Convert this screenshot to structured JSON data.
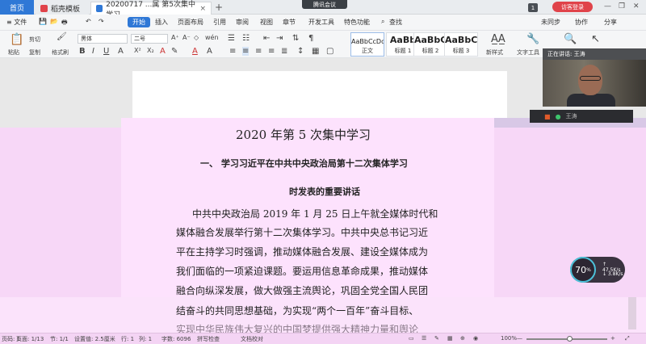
{
  "titlebar": {
    "tab_home": "首页",
    "tab_templates": "稻壳模板",
    "tab_doc": "20200717 ...属  第5次集中学习",
    "tab_close": "×",
    "add_tab": "+",
    "meeting_chip": "腾讯会议",
    "page_badge": "1",
    "visitor_button": "访客登录",
    "minimize": "—",
    "restore": "❐",
    "close": "✕"
  },
  "menubar": {
    "file": "≡ 文件",
    "items": [
      "开始",
      "插入",
      "页面布局",
      "引用",
      "审阅",
      "视图",
      "章节",
      "开发工具",
      "特色功能"
    ],
    "search": "查找",
    "sync": "未同步",
    "collab": "协作",
    "share": "分享"
  },
  "ribbon": {
    "paste": "粘贴",
    "cut": "剪切",
    "copy": "复制",
    "format_painter": "格式刷",
    "font_name": "黑体",
    "font_size": "二号",
    "styles": [
      {
        "sample": "AaBbCcDd",
        "name": "正文"
      },
      {
        "sample": "AaBb",
        "name": "标题 1"
      },
      {
        "sample": "AaBbC",
        "name": "标题 2"
      },
      {
        "sample": "AaBbC",
        "name": "标题 3"
      }
    ],
    "new_style": "新样式",
    "text_tools": "文字工具",
    "find_replace": "查找替换",
    "select": "选择"
  },
  "video": {
    "speaker_label": "正在讲话: 王涛",
    "participant_name": "王涛"
  },
  "document": {
    "title": "2020 年第 5 次集中学习",
    "heading_1": "一、 学习习近平在中共中央政治局第十二次集体学习",
    "heading_2": "时发表的重要讲话",
    "body_lines": [
      "中共中央政治局 2019 年 1 月 25 日上午就全媒体时代和",
      "媒体融合发展举行第十二次集体学习。中共中央总书记习近",
      "平在主持学习时强调，推动媒体融合发展、建设全媒体成为",
      "我们面临的一项紧迫课题。要运用信息革命成果，推动媒体",
      "融合向纵深发展，做大做强主流舆论，巩固全党全国人民团",
      "结奋斗的共同思想基础，为实现“两个一百年”奋斗目标、",
      "实现中华民族伟大复兴的中国梦提供强大精神力量和舆论"
    ]
  },
  "speed_widget": {
    "percent": "70",
    "percent_unit": "%",
    "upload": "↑ 47.5K/s",
    "download": "↓ 3.8K/s"
  },
  "statusbar": {
    "page_num": "页码: 1",
    "pages": "页面: 1/13",
    "section": "节: 1/1",
    "setting": "设置值: 2.5厘米",
    "row": "行: 1",
    "col": "列: 1",
    "word_count": "字数: 6096",
    "spell_check": "拼写检查",
    "doc_check": "文档校对",
    "zoom": "100%",
    "zoom_minus": "—",
    "zoom_plus": "+"
  },
  "colors": {
    "accent": "#2f78d6",
    "visitor": "#e0434a",
    "overlay_pink": "#f7d7f7"
  }
}
